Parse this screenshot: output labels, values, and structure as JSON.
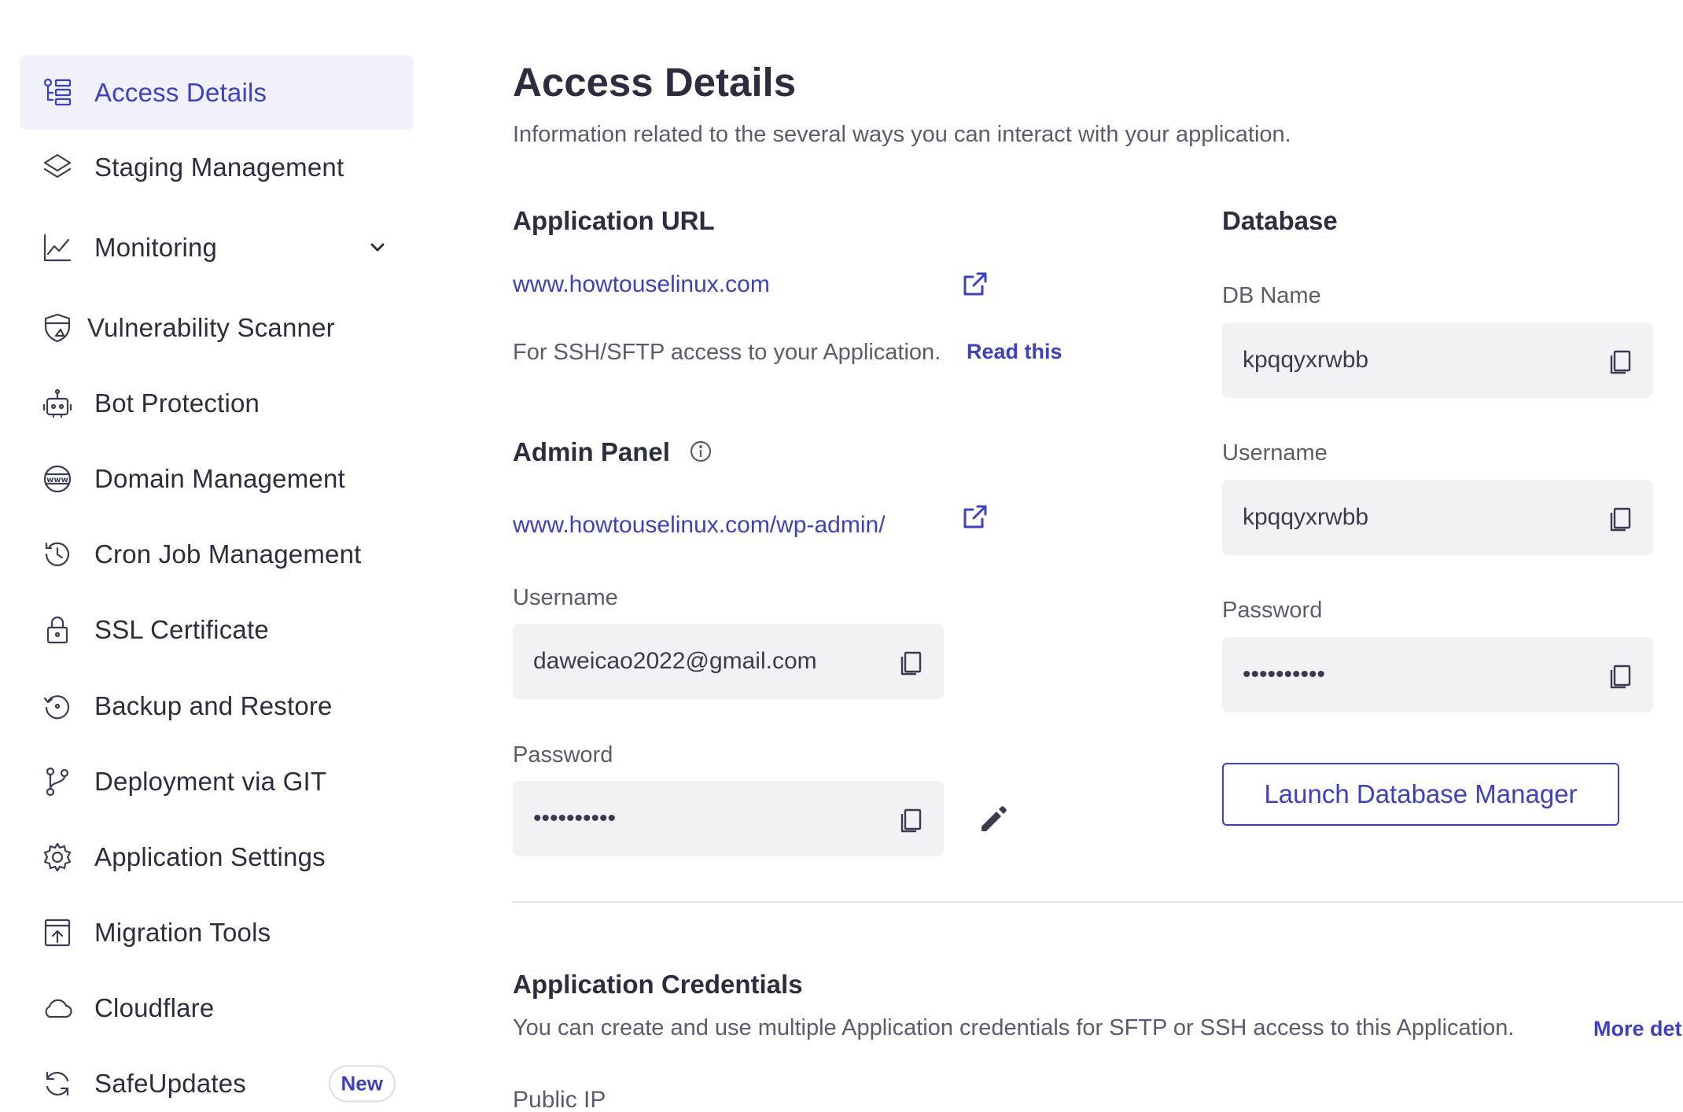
{
  "sidebar": {
    "items": [
      {
        "label": "Access Details",
        "icon": "access-details-icon",
        "active": true
      },
      {
        "label": "Staging Management",
        "icon": "layers-icon"
      },
      {
        "label": "Monitoring",
        "icon": "chart-line-icon",
        "has_chevron": true
      },
      {
        "label": "Vulnerability Scanner",
        "icon": "shield-scan-icon"
      },
      {
        "label": "Bot Protection",
        "icon": "robot-icon"
      },
      {
        "label": "Domain Management",
        "icon": "www-globe-icon"
      },
      {
        "label": "Cron Job Management",
        "icon": "history-clock-icon"
      },
      {
        "label": "SSL Certificate",
        "icon": "lock-icon"
      },
      {
        "label": "Backup and Restore",
        "icon": "restore-icon"
      },
      {
        "label": "Deployment via GIT",
        "icon": "git-branch-icon"
      },
      {
        "label": "Application Settings",
        "icon": "gear-icon"
      },
      {
        "label": "Migration Tools",
        "icon": "upload-box-icon"
      },
      {
        "label": "Cloudflare",
        "icon": "cloud-icon"
      },
      {
        "label": "SafeUpdates",
        "icon": "refresh-icon",
        "badge": "New"
      }
    ]
  },
  "main": {
    "title": "Access Details",
    "subtitle": "Information related to the several ways you can interact with your application.",
    "app_url": {
      "title": "Application URL",
      "url": "www.howtouselinux.com",
      "ssh_text": "For SSH/SFTP access to your Application.",
      "read_this": "Read this"
    },
    "admin_panel": {
      "title": "Admin Panel",
      "url": "www.howtouselinux.com/wp-admin/",
      "username_label": "Username",
      "username_value": "daweicao2022@gmail.com",
      "password_label": "Password",
      "password_value": "••••••••••"
    },
    "database": {
      "title": "Database",
      "db_name_label": "DB Name",
      "db_name_value": "kpqqyxrwbb",
      "username_label": "Username",
      "username_value": "kpqqyxrwbb",
      "password_label": "Password",
      "password_value": "••••••••••",
      "launch_button": "Launch Database Manager"
    },
    "credentials": {
      "title": "Application Credentials",
      "description": "You can create and use multiple Application credentials for SFTP or SSH access to this Application.",
      "more_link": "More det",
      "public_ip_label": "Public IP"
    }
  },
  "colors": {
    "accent": "#3d3fc9",
    "active_bg": "#f0f1fb",
    "field_bg": "#f2f2f5",
    "text": "#2c2e3f",
    "muted": "#5a5c6e"
  }
}
